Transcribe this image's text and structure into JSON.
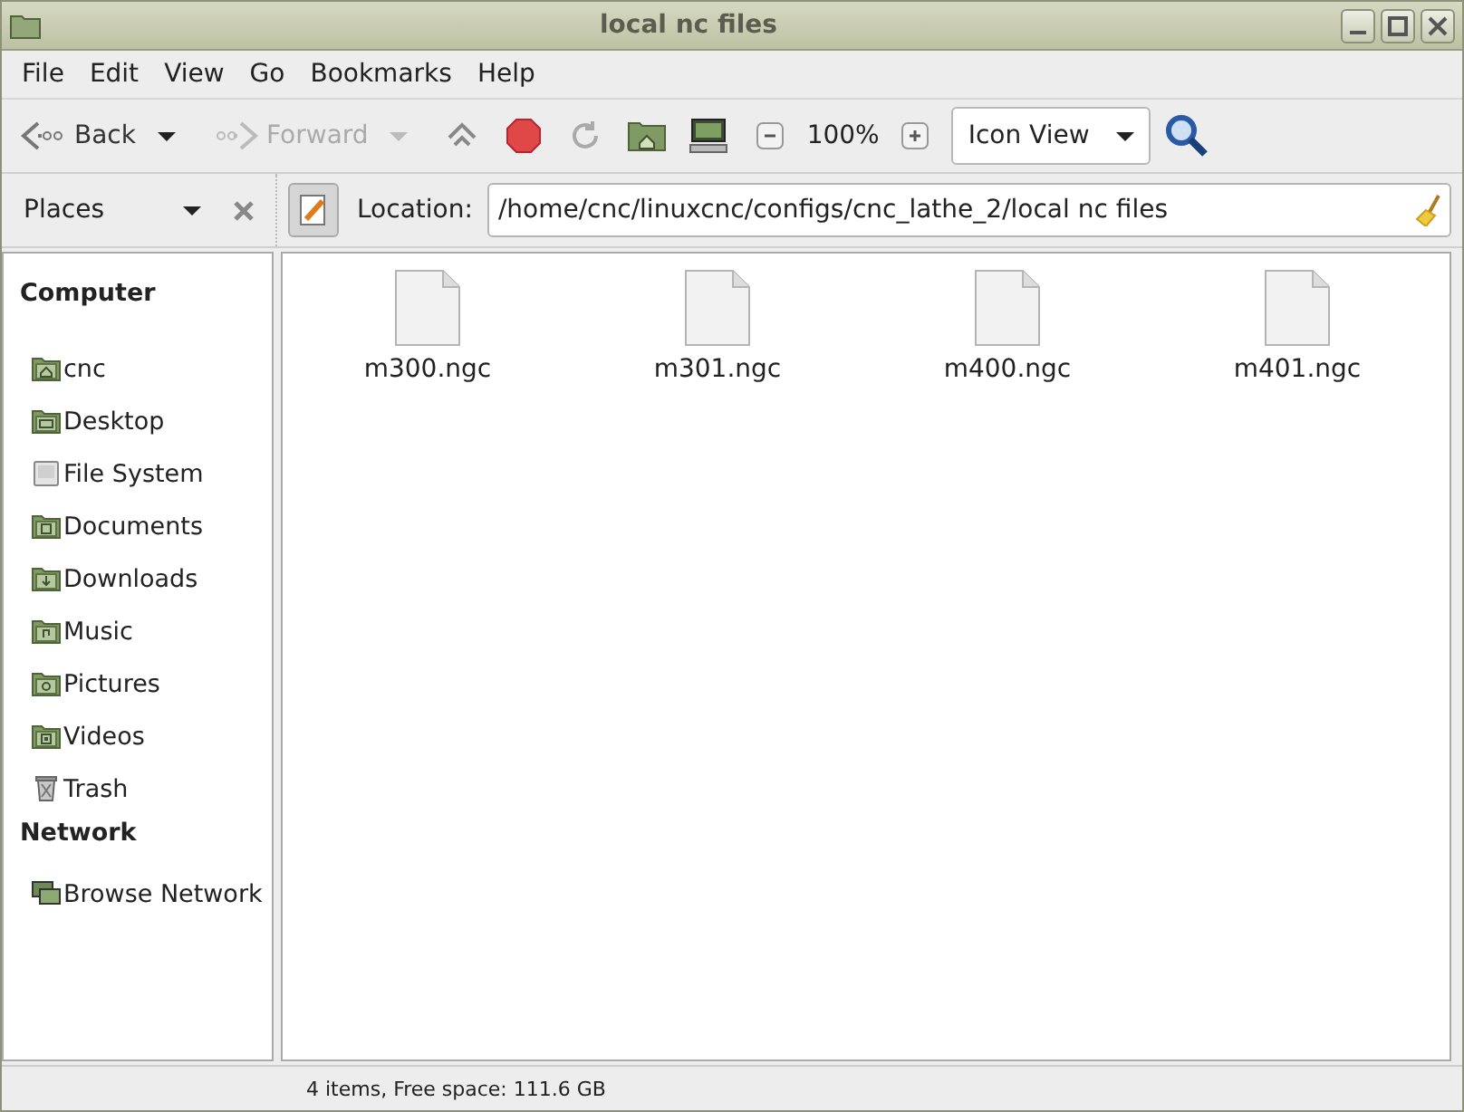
{
  "window": {
    "title": "local nc files"
  },
  "menu": [
    "File",
    "Edit",
    "View",
    "Go",
    "Bookmarks",
    "Help"
  ],
  "toolbar": {
    "back": {
      "label": "Back",
      "disabled": false
    },
    "forward": {
      "label": "Forward",
      "disabled": true
    },
    "zoom": "100%",
    "view": "Icon View"
  },
  "sidebar": {
    "title": "Places",
    "items": [
      {
        "kind": "heading",
        "label": "Computer"
      },
      {
        "kind": "place",
        "label": "cnc"
      },
      {
        "kind": "place",
        "label": "Desktop"
      },
      {
        "kind": "place",
        "label": "File System"
      },
      {
        "kind": "place",
        "label": "Documents"
      },
      {
        "kind": "place",
        "label": "Downloads"
      },
      {
        "kind": "place",
        "label": "Music"
      },
      {
        "kind": "place",
        "label": "Pictures"
      },
      {
        "kind": "place",
        "label": "Videos"
      },
      {
        "kind": "place",
        "label": "Trash"
      },
      {
        "kind": "heading",
        "label": "Network"
      },
      {
        "kind": "place",
        "label": "Browse Network"
      }
    ]
  },
  "location": {
    "label": "Location:",
    "value": "/home/cnc/linuxcnc/configs/cnc_lathe_2/local nc files"
  },
  "files": [
    "m300.ngc",
    "m301.ngc",
    "m400.ngc",
    "m401.ngc"
  ],
  "status_bar": "4 items, Free space: 111.6 GB"
}
